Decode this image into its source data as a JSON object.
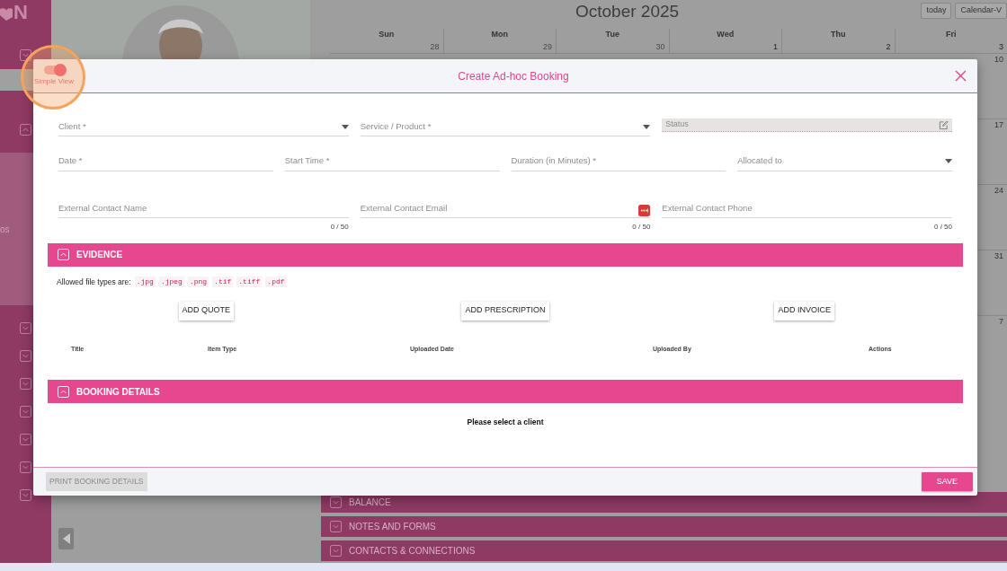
{
  "sidebar": {
    "logo": "N",
    "cut_text": "os",
    "items": [
      {
        "expanded": false
      },
      {
        "expanded": true
      },
      {
        "expanded": false
      },
      {
        "expanded": false
      },
      {
        "expanded": false
      },
      {
        "expanded": false
      },
      {
        "expanded": false
      },
      {
        "expanded": false
      },
      {
        "expanded": false
      }
    ]
  },
  "calendar": {
    "title": "October 2025",
    "buttons": [
      "today",
      "Calendar-V"
    ],
    "weekdays": [
      "Sun",
      "Mon",
      "Tue",
      "Wed",
      "Thu",
      "Fri"
    ],
    "first_week": [
      "28",
      "29",
      "30",
      "1",
      "2",
      "3"
    ],
    "last_column_dates": [
      "10",
      "17",
      "24",
      "31",
      "7"
    ]
  },
  "background_sections": [
    {
      "title": "BALANCE",
      "expanded": false
    },
    {
      "title": "NOTES AND FORMS",
      "expanded": false
    },
    {
      "title": "CONTACTS & CONNECTIONS",
      "expanded": false
    }
  ],
  "modal": {
    "title": "Create Ad-hoc Booking",
    "view_toggle": {
      "label": "Simple View",
      "on": true
    },
    "field_rows": [
      [
        {
          "kind": "select",
          "label": "Client *"
        },
        {
          "kind": "select",
          "label": "Service / Product *"
        },
        {
          "kind": "readonly",
          "label": "Status"
        }
      ],
      [
        {
          "kind": "text",
          "label": "Date *"
        },
        {
          "kind": "text",
          "label": "Start Time *"
        },
        {
          "kind": "text",
          "label": "Duration (in Minutes) *"
        },
        {
          "kind": "select",
          "label": "Allocated to"
        }
      ],
      [
        {
          "kind": "text",
          "label": "External Contact Name",
          "counter": "0 / 50"
        },
        {
          "kind": "email",
          "label": "External Contact Email",
          "counter": "0 / 50"
        },
        {
          "kind": "text",
          "label": "External Contact Phone",
          "counter": "0 / 50"
        }
      ]
    ],
    "evidence": {
      "title": "EVIDENCE",
      "expanded": true,
      "allowed_label": "Allowed file types are:",
      "file_types": [
        ".jpg",
        ".jpeg",
        ".png",
        ".tif",
        ".tiff",
        ".pdf"
      ],
      "buttons": [
        "ADD QUOTE",
        "ADD PRESCRIPTION",
        "ADD INVOICE"
      ],
      "columns": [
        "Title",
        "Item Type",
        "Uploaded Date",
        "Uploaded By",
        "Actions"
      ]
    },
    "booking_details": {
      "title": "BOOKING DETAILS",
      "expanded": true,
      "message": "Please select a client"
    },
    "footer": {
      "print_button": {
        "label": "PRINT BOOKING DETAILS",
        "disabled": true
      },
      "save_button": "SAVE"
    }
  }
}
